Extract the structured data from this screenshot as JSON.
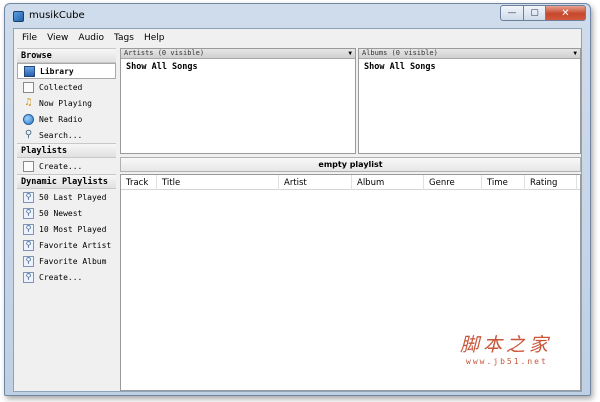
{
  "window": {
    "title": "musikCube",
    "min": "—",
    "max": "▢",
    "close": "✕"
  },
  "menu": [
    "File",
    "View",
    "Audio",
    "Tags",
    "Help"
  ],
  "sidebar": {
    "browse_header": "Browse",
    "browse_items": [
      {
        "label": "Library",
        "icon": "library-icon",
        "selected": true
      },
      {
        "label": "Collected",
        "icon": "collected-icon"
      },
      {
        "label": "Now Playing",
        "icon": "music-note-icon"
      },
      {
        "label": "Net Radio",
        "icon": "globe-icon"
      },
      {
        "label": "Search...",
        "icon": "search-icon"
      }
    ],
    "playlists_header": "Playlists",
    "playlist_items": [
      {
        "label": "Create...",
        "icon": "document-icon"
      }
    ],
    "dynamic_header": "Dynamic Playlists",
    "dynamic_items": [
      {
        "label": "50 Last Played",
        "icon": "dynamic-playlist-icon"
      },
      {
        "label": "50 Newest",
        "icon": "dynamic-playlist-icon"
      },
      {
        "label": "10 Most Played",
        "icon": "dynamic-playlist-icon"
      },
      {
        "label": "Favorite Artist",
        "icon": "dynamic-playlist-icon"
      },
      {
        "label": "Favorite Album",
        "icon": "dynamic-playlist-icon"
      },
      {
        "label": "Create...",
        "icon": "dynamic-playlist-icon"
      }
    ]
  },
  "artists_pane": {
    "header": "Artists (0 visible)",
    "row": "Show All Songs"
  },
  "albums_pane": {
    "header": "Albums (0 visible)",
    "row": "Show All Songs"
  },
  "playlist": {
    "title": "empty playlist",
    "columns": [
      "Track",
      "Title",
      "Artist",
      "Album",
      "Genre",
      "Time",
      "Rating"
    ]
  },
  "watermark": {
    "text": "脚本之家",
    "url": "www.jb51.net"
  }
}
